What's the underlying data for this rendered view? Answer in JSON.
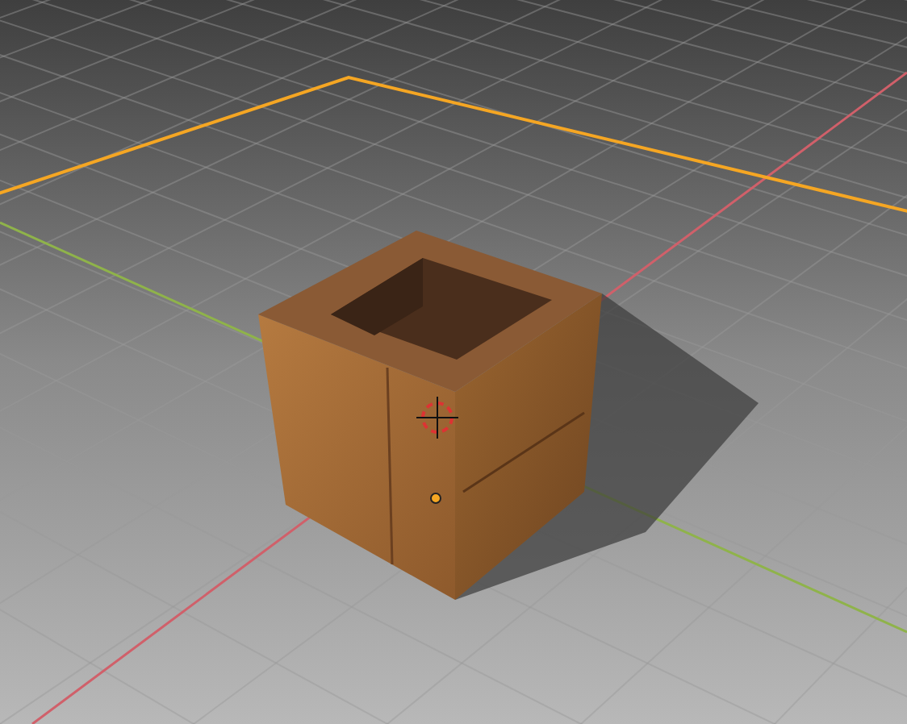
{
  "viewport": {
    "cursor_shown": true,
    "objects": [
      {
        "kind": "plane",
        "selected": true
      },
      {
        "kind": "box",
        "selected": false
      }
    ]
  }
}
